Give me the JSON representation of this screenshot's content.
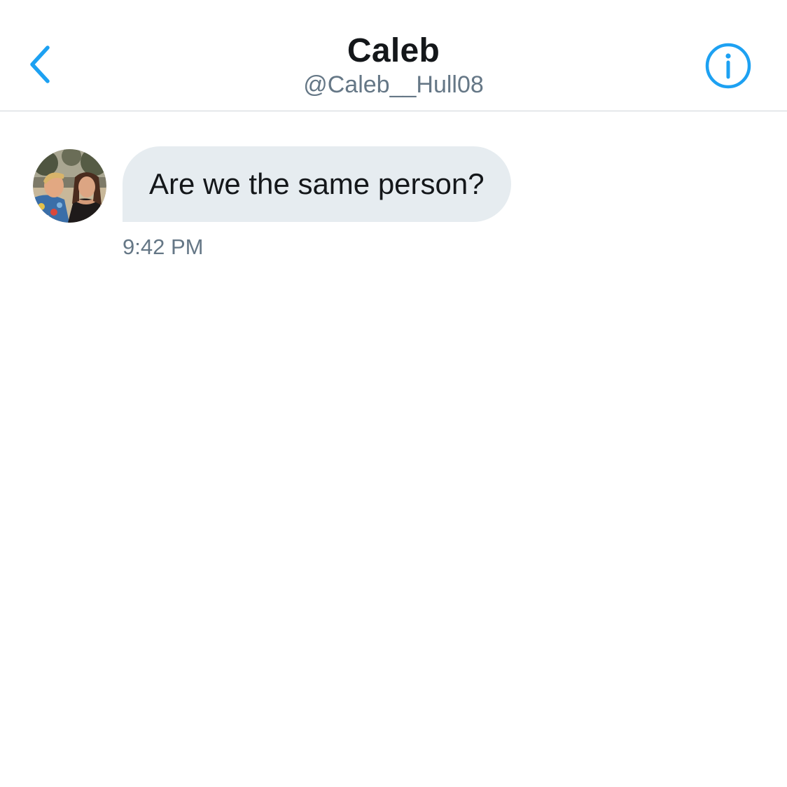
{
  "header": {
    "title": "Caleb",
    "handle": "@Caleb__Hull08",
    "back_icon": "chevron-left-icon",
    "info_icon": "info-icon",
    "accent_color": "#1da1f2"
  },
  "conversation": {
    "messages": [
      {
        "text": "Are we the same person?",
        "time": "9:42 PM",
        "direction": "received",
        "avatar": "contact-avatar"
      }
    ]
  },
  "colors": {
    "bubble_received": "#e6ecf0",
    "text_primary": "#14171a",
    "text_secondary": "#657786",
    "divider": "#cfd4d9"
  }
}
